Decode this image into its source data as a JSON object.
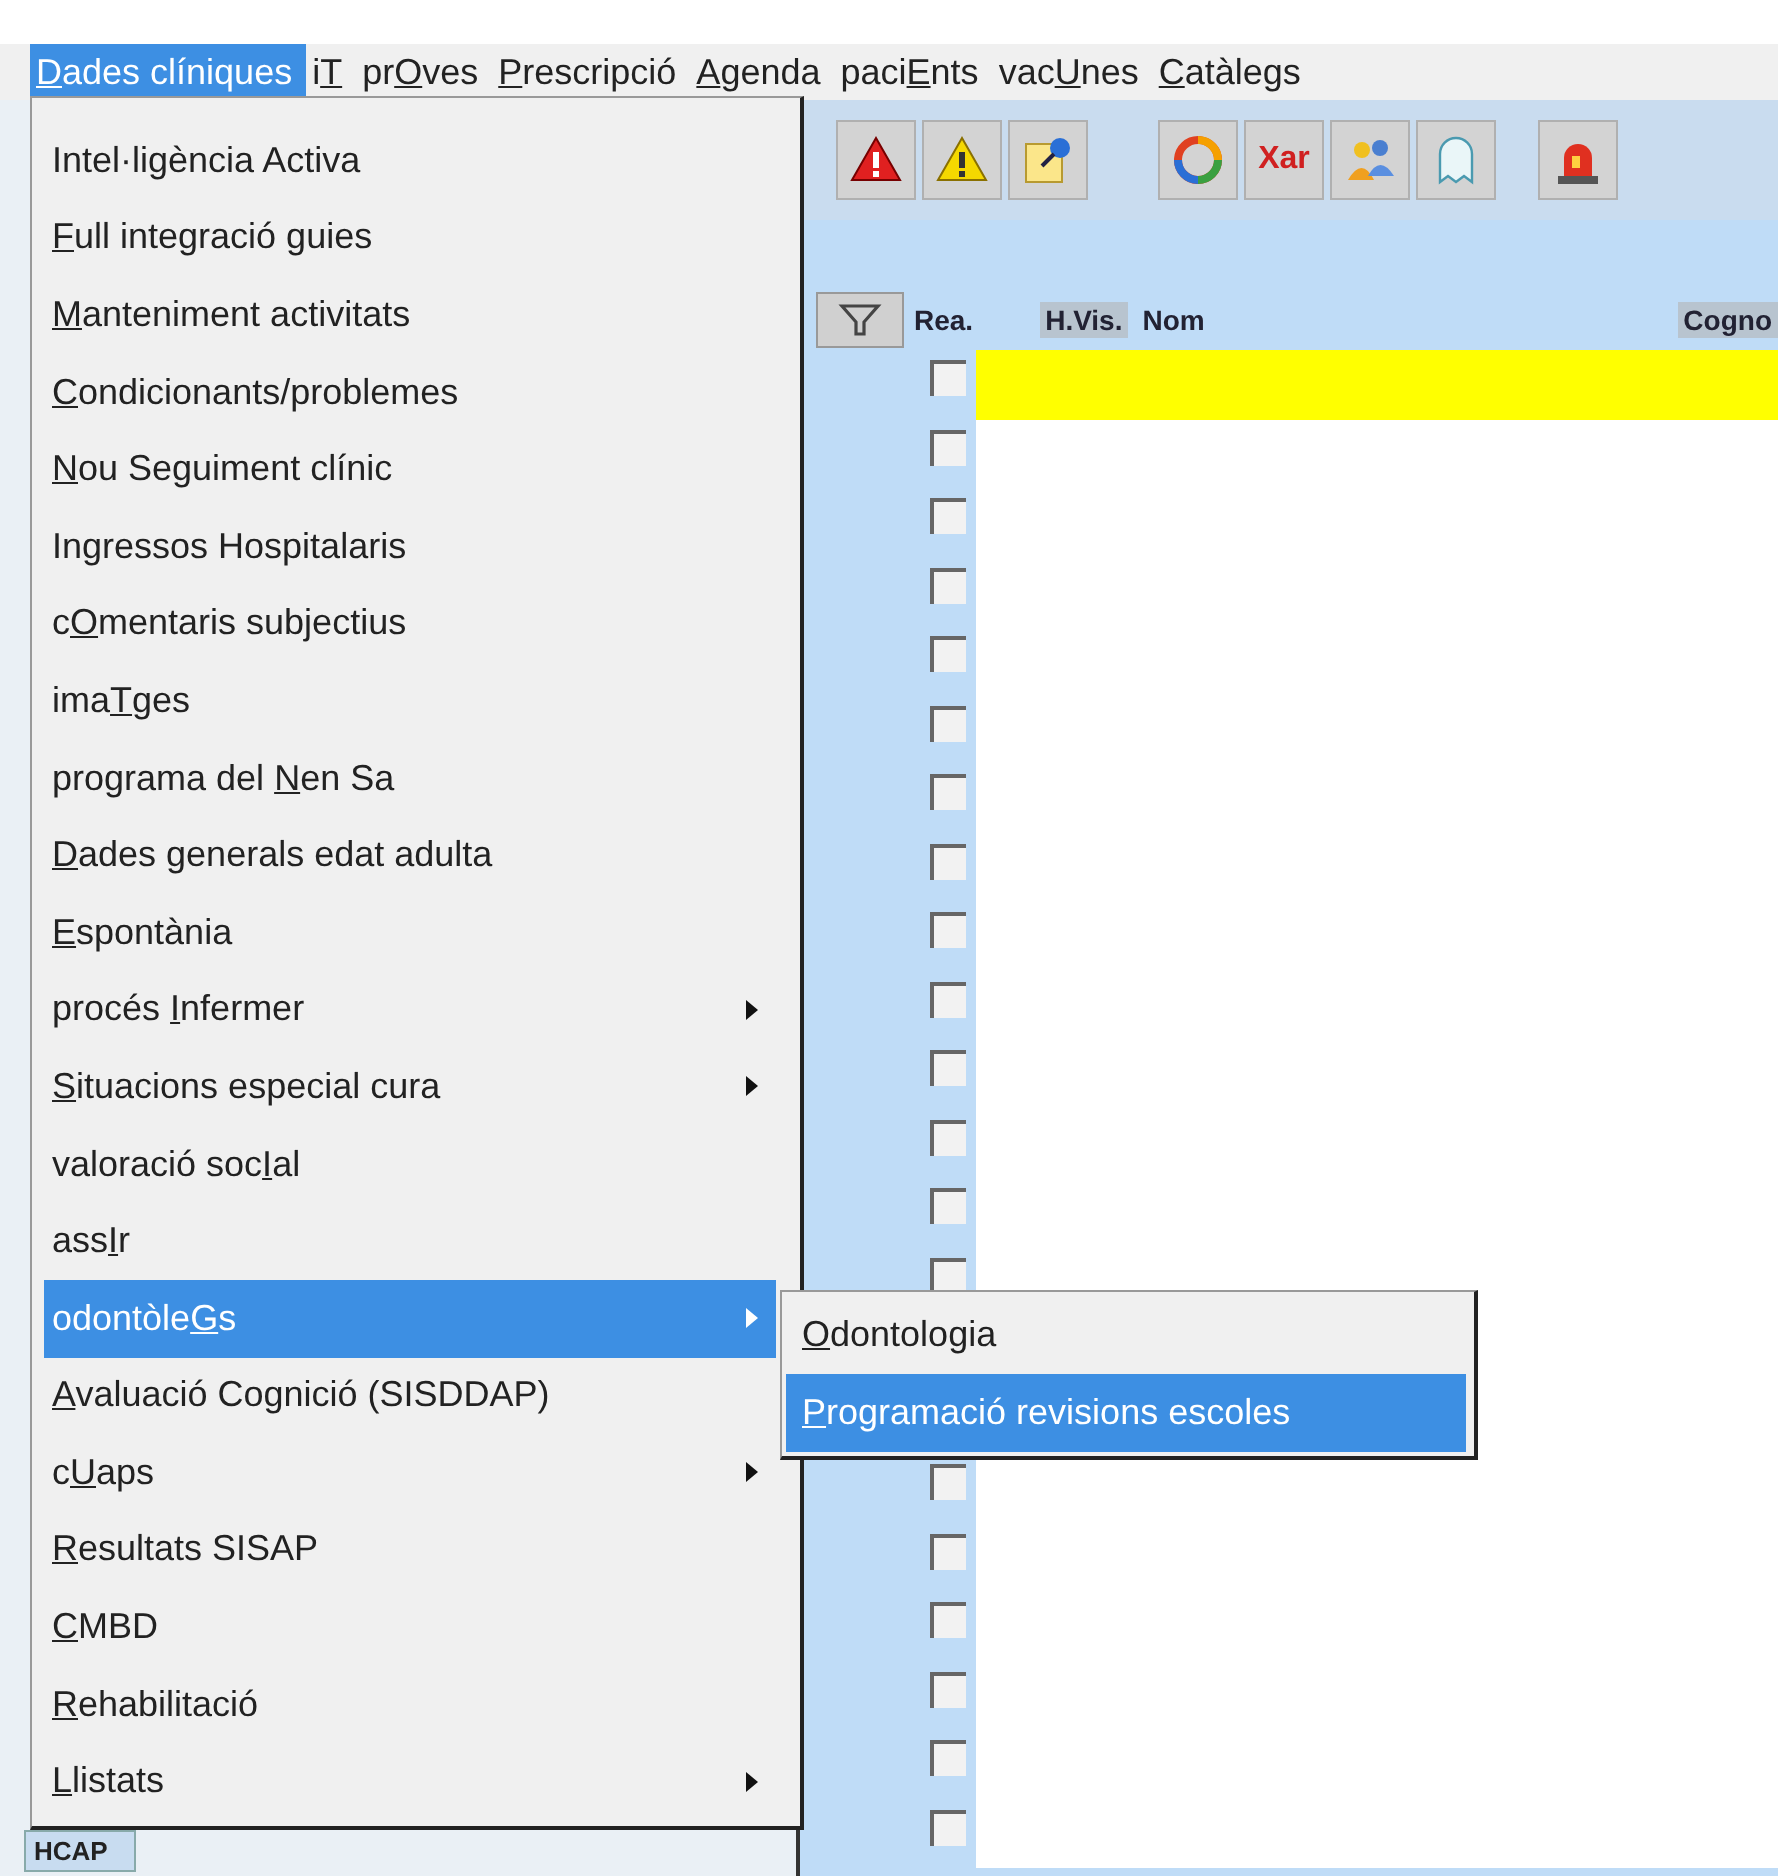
{
  "menubar": [
    {
      "label": {
        "key": "D",
        "post": "ades clíniques"
      },
      "selected": true
    },
    {
      "label": {
        "pre": "i",
        "key": "T"
      },
      "selected": false
    },
    {
      "label": {
        "pre": "pr",
        "key": "O",
        "post": "ves"
      },
      "selected": false
    },
    {
      "label": {
        "key": "P",
        "post": "rescripció"
      },
      "selected": false
    },
    {
      "label": {
        "key": "A",
        "post": "genda"
      },
      "selected": false
    },
    {
      "label": {
        "pre": "paci",
        "key": "E",
        "post": "nts"
      },
      "selected": false
    },
    {
      "label": {
        "pre": "vac",
        "key": "U",
        "post": "nes"
      },
      "selected": false
    },
    {
      "label": {
        "key": "C",
        "post": "atàlegs"
      },
      "selected": false
    }
  ],
  "toolbar": [
    {
      "kind": "alert-red"
    },
    {
      "kind": "alert-yellow"
    },
    {
      "kind": "note"
    },
    {
      "kind": "refresh"
    },
    {
      "kind": "text",
      "label": "Xar"
    },
    {
      "kind": "people"
    },
    {
      "kind": "ghost"
    },
    {
      "kind": "siren"
    }
  ],
  "table": {
    "columns": [
      "Rea.",
      "H.Vis.",
      "Nom",
      "Cogno"
    ],
    "rows": [
      {
        "selected": true,
        "checked": false
      },
      {
        "selected": false,
        "checked": false
      },
      {
        "selected": false,
        "checked": false
      },
      {
        "selected": false,
        "checked": false
      },
      {
        "selected": false,
        "checked": false
      },
      {
        "selected": false,
        "checked": false
      },
      {
        "selected": false,
        "checked": false
      },
      {
        "selected": false,
        "checked": false
      },
      {
        "selected": false,
        "checked": false
      },
      {
        "selected": false,
        "checked": false
      },
      {
        "selected": false,
        "checked": false
      },
      {
        "selected": false,
        "checked": false
      },
      {
        "selected": false,
        "checked": false
      },
      {
        "selected": false,
        "checked": false
      },
      {
        "selected": false
      },
      {
        "selected": false
      },
      {
        "selected": false,
        "checked": false
      },
      {
        "selected": false,
        "checked": false
      },
      {
        "selected": false,
        "checked": false
      },
      {
        "selected": false,
        "checked": false
      },
      {
        "selected": false,
        "checked": false
      },
      {
        "selected": false,
        "checked": false
      }
    ]
  },
  "bottom_tab": "HCAP",
  "menu": [
    {
      "label": {
        "pre": "Intel·ligència Activa"
      },
      "submenu": false,
      "selected": false
    },
    {
      "label": {
        "key": "F",
        "post": "ull integració guies"
      },
      "submenu": false,
      "selected": false
    },
    {
      "label": {
        "key": "M",
        "post": "anteniment activitats"
      },
      "submenu": false,
      "selected": false
    },
    {
      "label": {
        "key": "C",
        "post": "ondicionants/problemes"
      },
      "submenu": false,
      "selected": false
    },
    {
      "label": {
        "key": "N",
        "post": "ou Seguiment clínic"
      },
      "submenu": false,
      "selected": false
    },
    {
      "label": {
        "pre": "Ingressos Hospitalaris"
      },
      "submenu": false,
      "selected": false
    },
    {
      "label": {
        "pre": "c",
        "key": "O",
        "post": "mentaris subjectius"
      },
      "submenu": false,
      "selected": false
    },
    {
      "label": {
        "pre": "ima",
        "key": "T",
        "post": "ges"
      },
      "submenu": false,
      "selected": false
    },
    {
      "label": {
        "pre": "programa del ",
        "key": "N",
        "post": "en Sa"
      },
      "submenu": false,
      "selected": false
    },
    {
      "label": {
        "key": "D",
        "post": "ades generals edat adulta"
      },
      "submenu": false,
      "selected": false
    },
    {
      "label": {
        "key": "E",
        "post": "spontània"
      },
      "submenu": false,
      "selected": false
    },
    {
      "label": {
        "pre": "procés ",
        "key": "I",
        "post": "nfermer"
      },
      "submenu": true,
      "selected": false
    },
    {
      "label": {
        "key": "S",
        "post": "ituacions especial cura"
      },
      "submenu": true,
      "selected": false
    },
    {
      "label": {
        "pre": "valoració soc",
        "key": "I",
        "post": "al"
      },
      "submenu": false,
      "selected": false
    },
    {
      "label": {
        "pre": "ass",
        "key": "I",
        "post": "r"
      },
      "submenu": false,
      "selected": false
    },
    {
      "label": {
        "pre": "odontòle",
        "key": "G",
        "post": "s"
      },
      "submenu": true,
      "selected": true
    },
    {
      "label": {
        "key": "A",
        "post": "valuació Cognició (SISDDAP)"
      },
      "submenu": false,
      "selected": false
    },
    {
      "label": {
        "pre": "c",
        "key": "U",
        "post": "aps"
      },
      "submenu": true,
      "selected": false
    },
    {
      "label": {
        "key": "R",
        "post": "esultats SISAP"
      },
      "submenu": false,
      "selected": false
    },
    {
      "label": {
        "key": "C",
        "post": "MBD"
      },
      "submenu": false,
      "selected": false
    },
    {
      "label": {
        "key": "R",
        "post": "ehabilitació"
      },
      "submenu": false,
      "selected": false
    },
    {
      "label": {
        "key": "L",
        "post": "listats"
      },
      "submenu": true,
      "selected": false
    }
  ],
  "submenu": [
    {
      "label": {
        "key": "O",
        "post": "dontologia"
      },
      "selected": false
    },
    {
      "label": {
        "key": "P",
        "post": "rogramació revisions escoles"
      },
      "selected": true
    }
  ]
}
